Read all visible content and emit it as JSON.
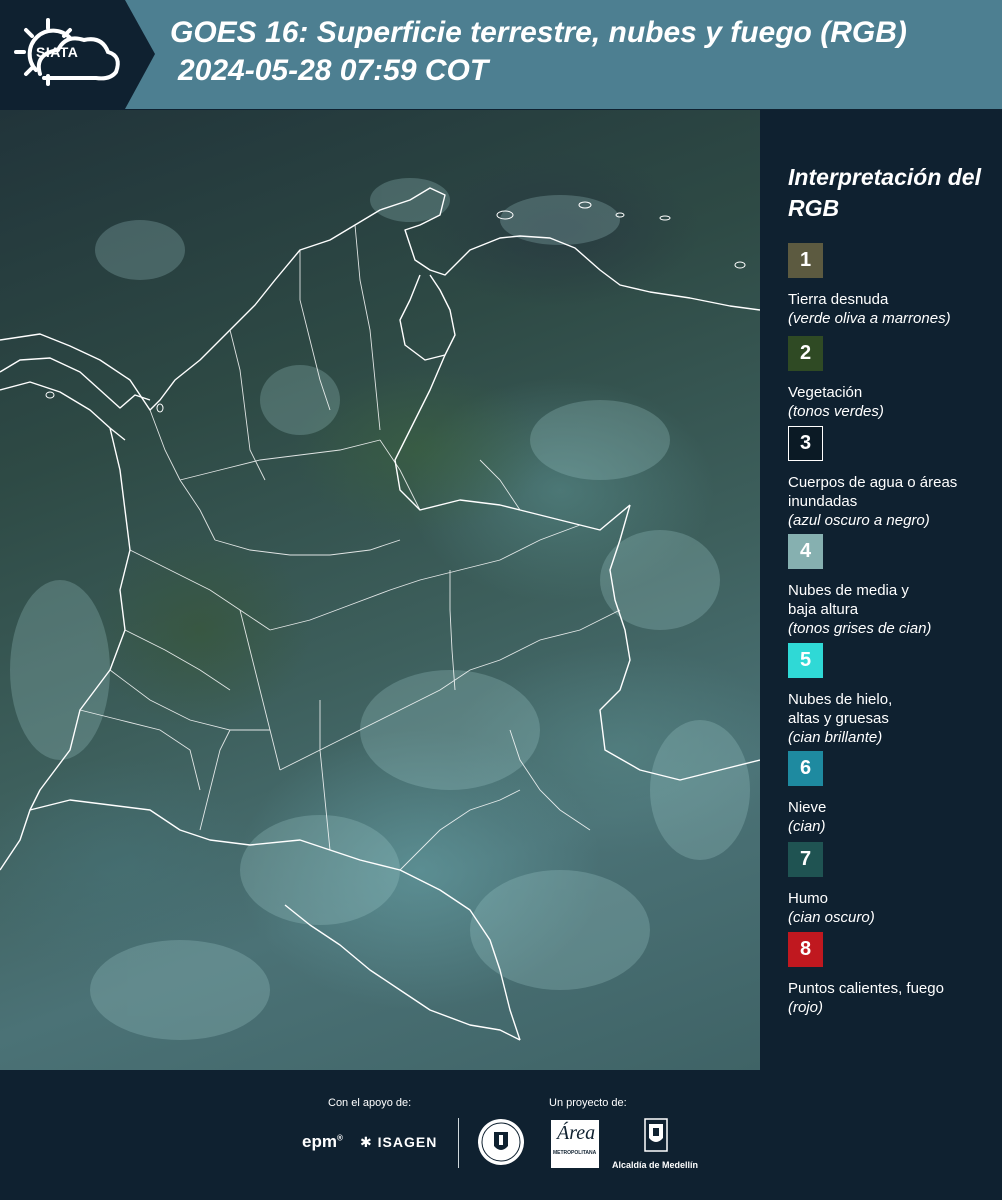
{
  "header": {
    "logo_text": "SIATA",
    "title_line1": "GOES 16: Superficie terrestre, nubes y fuego (RGB)",
    "title_line2": "2024-05-28 07:59 COT"
  },
  "map": {
    "description_icon": "satellite-rgb-composite-image"
  },
  "legend": {
    "title": "Interpretación del RGB",
    "items": [
      {
        "number": "1",
        "label": "Tierra desnuda",
        "desc": "(verde oliva a marrones)",
        "color": "#5c5a40"
      },
      {
        "number": "2",
        "label": "Vegetación",
        "desc": "(tonos verdes)",
        "color": "#2f4a24"
      },
      {
        "number": "3",
        "label": "Cuerpos de agua o áreas inundadas",
        "desc": "(azul oscuro a negro)",
        "color": "#0b1a25"
      },
      {
        "number": "4",
        "label": "Nubes de media y baja altura",
        "desc": "(tonos grises de cian)",
        "color": "#86b0b0"
      },
      {
        "number": "5",
        "label": "Nubes de hielo, altas y gruesas",
        "desc": "(cian brillante)",
        "color": "#2fd9d6"
      },
      {
        "number": "6",
        "label": "Nieve",
        "desc": "(cian)",
        "color": "#1e8aa0"
      },
      {
        "number": "7",
        "label": "Humo",
        "desc": "(cian oscuro)",
        "color": "#1f5352"
      },
      {
        "number": "8",
        "label": "Puntos calientes, fuego",
        "desc": "(rojo)",
        "color": "#c0181f"
      }
    ]
  },
  "footer": {
    "support_label": "Con el apoyo de:",
    "project_label": "Un proyecto de:",
    "epm": "epm",
    "epm_mark": "®",
    "isagen": "ISAGEN",
    "area_logo_letter": "Área",
    "area_logo_text": "METROPOLITANA",
    "alcaldia": "Alcaldía de Medellín"
  }
}
